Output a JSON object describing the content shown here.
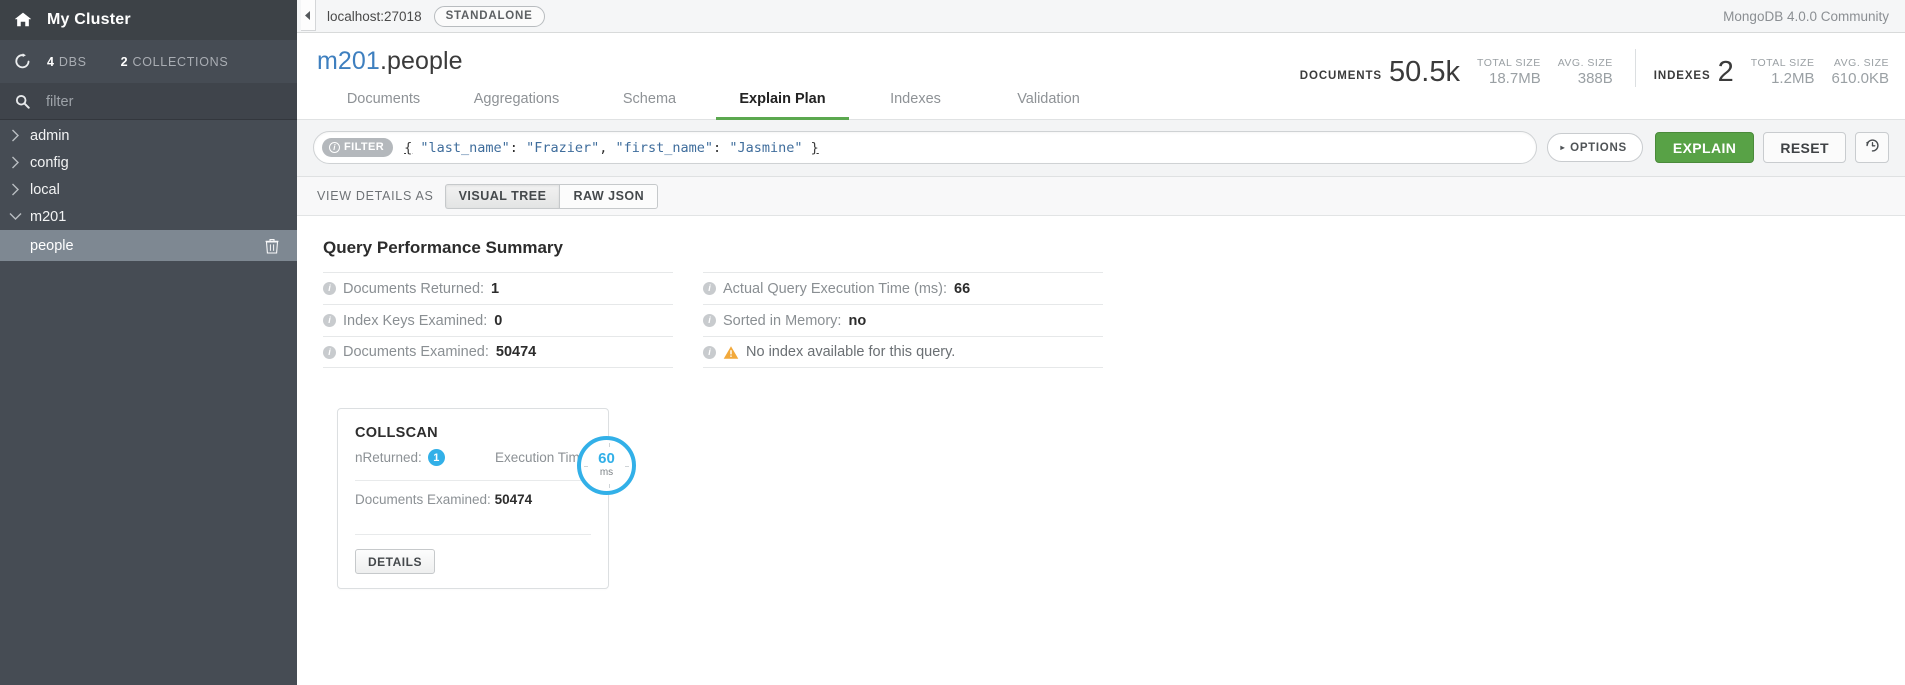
{
  "sidebar": {
    "cluster_name": "My Cluster",
    "home_icon": "home-icon",
    "refresh_icon": "refresh-icon",
    "db_count": "4",
    "db_count_label": "DBS",
    "collection_count": "2",
    "collection_count_label": "COLLECTIONS",
    "search_icon": "search-icon",
    "filter_placeholder": "filter",
    "filter_value": "",
    "databases": [
      {
        "name": "admin",
        "expanded": false
      },
      {
        "name": "config",
        "expanded": false
      },
      {
        "name": "local",
        "expanded": false
      },
      {
        "name": "m201",
        "expanded": true
      }
    ],
    "collections": [
      {
        "name": "people",
        "selected": true,
        "delete_icon": "trash-icon"
      }
    ]
  },
  "topbar": {
    "collapse_icon": "caret-left-icon",
    "host": "localhost:27018",
    "topology_badge": "STANDALONE",
    "version": "MongoDB 4.0.0 Community"
  },
  "namespace": {
    "database": "m201",
    "collection": ".people"
  },
  "stats": {
    "documents_label": "DOCUMENTS",
    "documents_value": "50.5k",
    "documents_total_size_label": "TOTAL SIZE",
    "documents_total_size": "18.7MB",
    "documents_avg_size_label": "AVG. SIZE",
    "documents_avg_size": "388B",
    "indexes_label": "INDEXES",
    "indexes_value": "2",
    "indexes_total_size_label": "TOTAL SIZE",
    "indexes_total_size": "1.2MB",
    "indexes_avg_size_label": "AVG. SIZE",
    "indexes_avg_size": "610.0KB"
  },
  "tabs": [
    {
      "label": "Documents",
      "active": false
    },
    {
      "label": "Aggregations",
      "active": false
    },
    {
      "label": "Schema",
      "active": false
    },
    {
      "label": "Explain Plan",
      "active": true
    },
    {
      "label": "Indexes",
      "active": false
    },
    {
      "label": "Validation",
      "active": false
    }
  ],
  "filter_bar": {
    "pill_label": "FILTER",
    "pill_icon": "info-icon",
    "query_open_brace": "{",
    "query_field1_key": "\"last_name\"",
    "query_field1_value": "\"Frazier\"",
    "query_field2_key": "\"first_name\"",
    "query_field2_value": "\"Jasmine\"",
    "query_close_brace": "}",
    "query_raw": "{ \"last_name\": \"Frazier\", \"first_name\": \"Jasmine\" }",
    "options_label": "OPTIONS",
    "options_caret": "caret-right-icon",
    "explain_label": "EXPLAIN",
    "reset_label": "RESET",
    "history_icon": "history-icon",
    "explain_color": "#58a246"
  },
  "view_details": {
    "label": "VIEW DETAILS AS",
    "options": [
      {
        "label": "VISUAL TREE",
        "selected": true
      },
      {
        "label": "RAW JSON",
        "selected": false
      }
    ]
  },
  "summary": {
    "title": "Query Performance Summary",
    "left": [
      {
        "info_icon": "info-icon",
        "label": "Documents Returned:",
        "value": "1"
      },
      {
        "info_icon": "info-icon",
        "label": "Index Keys Examined:",
        "value": "0"
      },
      {
        "info_icon": "info-icon",
        "label": "Documents Examined:",
        "value": "50474"
      }
    ],
    "right": [
      {
        "info_icon": "info-icon",
        "label": "Actual Query Execution Time (ms):",
        "value": "66"
      },
      {
        "info_icon": "info-icon",
        "label": "Sorted in Memory:",
        "value": "no"
      }
    ],
    "warning": {
      "info_icon": "info-icon",
      "warning_icon": "warning-triangle-icon",
      "text": "No index available for this query.",
      "color": "#f2a93b"
    }
  },
  "stage": {
    "name": "COLLSCAN",
    "nreturned_label": "nReturned:",
    "nreturned_value": "1",
    "exec_time_label": "Execution Time:",
    "exec_time_value": "60",
    "exec_time_unit": "ms",
    "docs_examined_label": "Documents Examined:",
    "docs_examined_value": "50474",
    "details_label": "DETAILS",
    "accent_color": "#32b0e8"
  }
}
